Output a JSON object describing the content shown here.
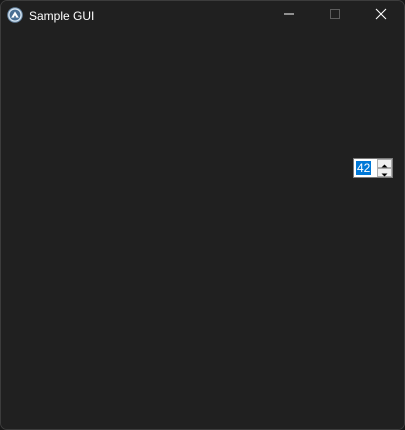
{
  "window": {
    "title": "Sample GUI",
    "app_icon": "autoit-logo-icon"
  },
  "title_controls": {
    "minimize": "minimize-icon",
    "maximize": "maximize-icon",
    "close": "close-icon"
  },
  "updown": {
    "value": "42",
    "up_icon": "chevron-up-icon",
    "down_icon": "chevron-down-icon"
  },
  "colors": {
    "background": "#202020",
    "title_text": "#ffffff",
    "selection": "#0078d7"
  }
}
